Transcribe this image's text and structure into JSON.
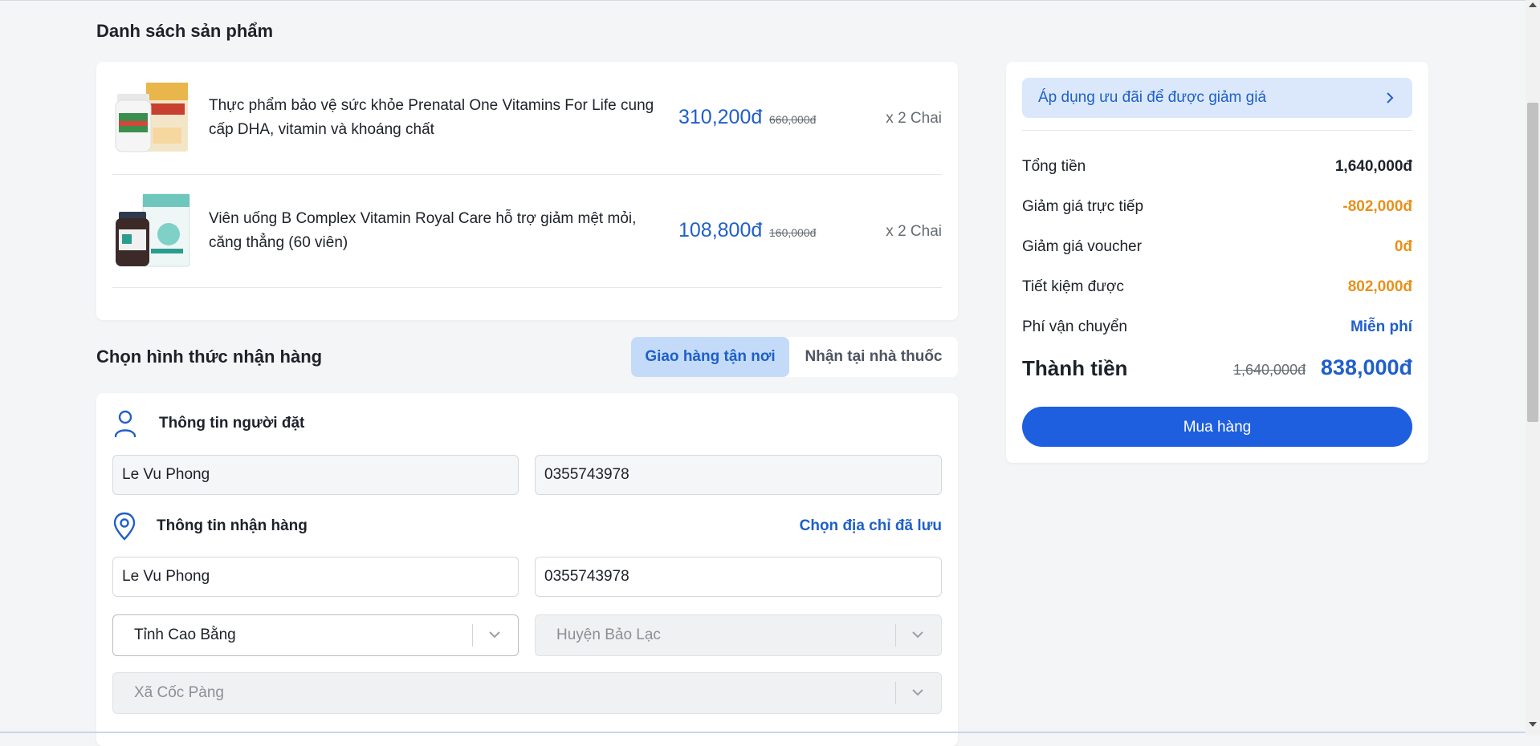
{
  "products_section": {
    "title": "Danh sách sản phẩm",
    "items": [
      {
        "name": "Thực phẩm bảo vệ sức khỏe Prenatal One Vitamins For Life cung cấp DHA, vitamin và khoáng chất",
        "price": "310,200đ",
        "old_price": "660,000đ",
        "quantity": "x 2 Chai",
        "image_icon": "prenatal-product-image"
      },
      {
        "name": "Viên uống B Complex Vitamin Royal Care hỗ trợ giảm mệt mỏi, căng thẳng (60 viên)",
        "price": "108,800đ",
        "old_price": "160,000đ",
        "quantity": "x 2 Chai",
        "image_icon": "b-complex-product-image"
      }
    ]
  },
  "delivery": {
    "title": "Chọn hình thức nhận hàng",
    "options": [
      "Giao hàng tận nơi",
      "Nhận tại nhà thuốc"
    ],
    "selected": "Giao hàng tận nơi"
  },
  "orderer": {
    "heading": "Thông tin người đặt",
    "name": "Le Vu Phong",
    "phone": "0355743978"
  },
  "receiver": {
    "heading": "Thông tin nhận hàng",
    "saved_address_link": "Chọn địa chỉ đã lưu",
    "name": "Le Vu Phong",
    "phone": "0355743978",
    "province": "Tỉnh Cao Bằng",
    "district": "Huyện Bảo Lạc",
    "ward": "Xã Cốc Pàng"
  },
  "summary": {
    "promo_label": "Áp dụng ưu đãi để được giảm giá",
    "rows": [
      {
        "label": "Tổng tiền",
        "value": "1,640,000đ"
      },
      {
        "label": "Giảm giá trực tiếp",
        "value": "-802,000đ"
      },
      {
        "label": "Giảm giá voucher",
        "value": "0đ"
      },
      {
        "label": "Tiết kiệm được",
        "value": "802,000đ"
      },
      {
        "label": "Phí vận chuyển",
        "value": "Miễn phí"
      }
    ],
    "total_label": "Thành tiền",
    "total_old": "1,640,000đ",
    "total": "838,000đ",
    "buy_button": "Mua hàng"
  },
  "colors": {
    "accent": "#1f5fc9",
    "button": "#1e5fe0",
    "discount": "#e8901a",
    "background": "#f4f5f7"
  }
}
